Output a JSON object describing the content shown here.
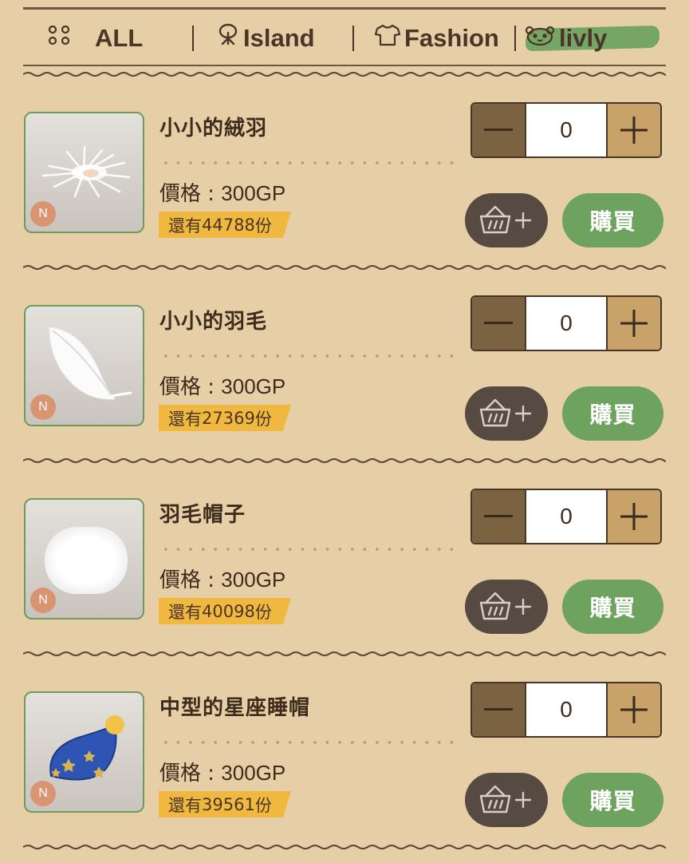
{
  "tabs": {
    "all": "ALL",
    "island": "Island",
    "fashion": "Fashion",
    "livly": "livly",
    "active": "livly",
    "active_color": "#6da35f"
  },
  "items": [
    {
      "name": "小小的絨羽",
      "price_label": "價格 : ",
      "price": "300GP",
      "stock_prefix": "還有 ",
      "stock_count": "44788",
      "stock_suffix": "份",
      "quantity": "0",
      "rarity": "N",
      "buy_label": "購買",
      "image": "fluff-feather"
    },
    {
      "name": "小小的羽毛",
      "price_label": "價格 : ",
      "price": "300GP",
      "stock_prefix": "還有 ",
      "stock_count": "27369",
      "stock_suffix": "份",
      "quantity": "0",
      "rarity": "N",
      "buy_label": "購買",
      "image": "white-feather"
    },
    {
      "name": "羽毛帽子",
      "price_label": "價格 : ",
      "price": "300GP",
      "stock_prefix": "還有 ",
      "stock_count": "40098",
      "stock_suffix": "份",
      "quantity": "0",
      "rarity": "N",
      "buy_label": "購買",
      "image": "feather-hat"
    },
    {
      "name": "中型的星座睡帽",
      "price_label": "價格 : ",
      "price": "300GP",
      "stock_prefix": "還有 ",
      "stock_count": "39561",
      "stock_suffix": "份",
      "quantity": "0",
      "rarity": "N",
      "buy_label": "購買",
      "image": "star-nightcap"
    }
  ],
  "colors": {
    "background": "#e6cfa7",
    "buy_button": "#6da35f",
    "stock_badge": "#f0b83f",
    "cart_button": "#574a42",
    "rarity_badge": "#d99572"
  }
}
